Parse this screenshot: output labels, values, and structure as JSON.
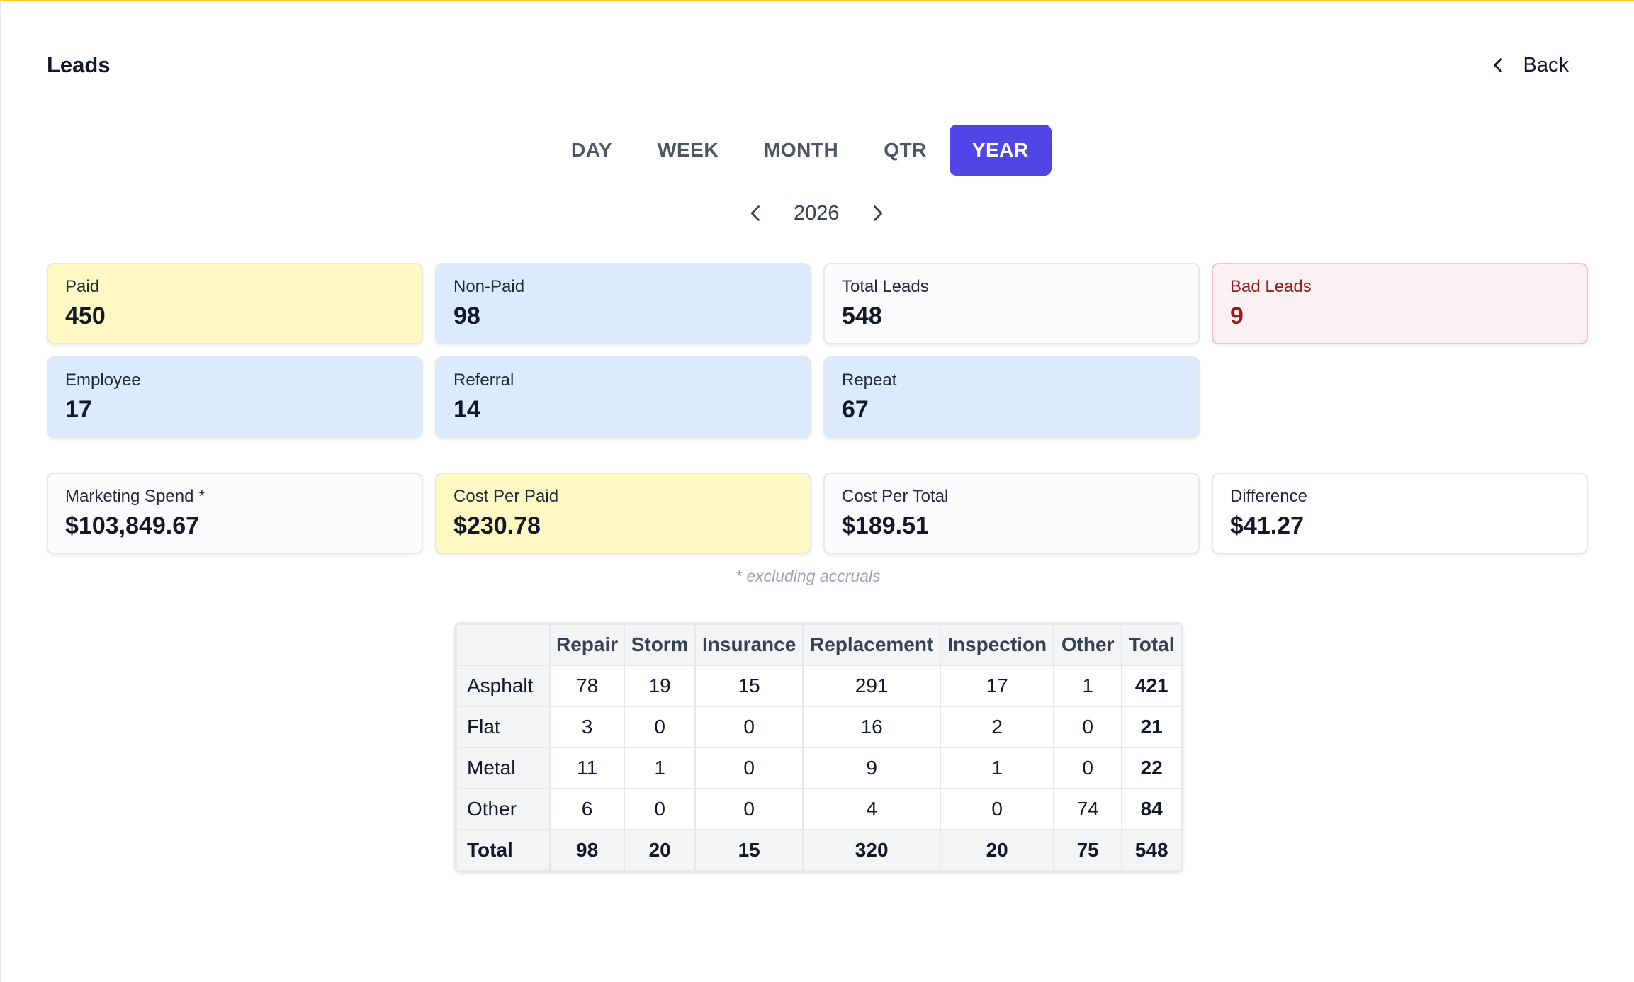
{
  "header": {
    "title": "Leads",
    "back_label": "Back"
  },
  "period_tabs": [
    {
      "label": "DAY",
      "active": false
    },
    {
      "label": "WEEK",
      "active": false
    },
    {
      "label": "MONTH",
      "active": false
    },
    {
      "label": "QTR",
      "active": false
    },
    {
      "label": "YEAR",
      "active": true
    }
  ],
  "year_nav": {
    "year": "2026"
  },
  "lead_cards": [
    {
      "label": "Paid",
      "value": "450"
    },
    {
      "label": "Non-Paid",
      "value": "98"
    },
    {
      "label": "Total Leads",
      "value": "548"
    },
    {
      "label": "Bad Leads",
      "value": "9"
    },
    {
      "label": "Employee",
      "value": "17"
    },
    {
      "label": "Referral",
      "value": "14"
    },
    {
      "label": "Repeat",
      "value": "67"
    }
  ],
  "cost_cards": [
    {
      "label": "Marketing Spend *",
      "value": "$103,849.67"
    },
    {
      "label": "Cost Per Paid",
      "value": "$230.78"
    },
    {
      "label": "Cost Per Total",
      "value": "$189.51"
    },
    {
      "label": "Difference",
      "value": "$41.27"
    }
  ],
  "footnote": "* excluding accruals",
  "table": {
    "columns": [
      "",
      "Repair",
      "Storm",
      "Insurance",
      "Replacement",
      "Inspection",
      "Other",
      "Total"
    ],
    "rows": [
      {
        "label": "Asphalt",
        "cells": [
          "78",
          "19",
          "15",
          "291",
          "17",
          "1",
          "421"
        ]
      },
      {
        "label": "Flat",
        "cells": [
          "3",
          "0",
          "0",
          "16",
          "2",
          "0",
          "21"
        ]
      },
      {
        "label": "Metal",
        "cells": [
          "11",
          "1",
          "0",
          "9",
          "1",
          "0",
          "22"
        ]
      },
      {
        "label": "Other",
        "cells": [
          "6",
          "0",
          "0",
          "4",
          "0",
          "74",
          "84"
        ]
      },
      {
        "label": "Total",
        "cells": [
          "98",
          "20",
          "15",
          "320",
          "20",
          "75",
          "548"
        ]
      }
    ]
  },
  "colors": {
    "accent": "#4f46e5",
    "paid_bg": "#fef9c3",
    "blue_bg": "#dbeafe",
    "bad_text": "#991b1b",
    "top_border": "#facc15"
  },
  "icons": {
    "back": "chevron-left-icon",
    "prev": "chevron-left-icon",
    "next": "chevron-right-icon"
  }
}
